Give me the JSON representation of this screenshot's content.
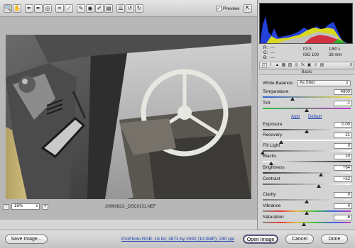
{
  "toolbar": {
    "tools": [
      {
        "icon": "zoom-icon",
        "glyph": "🔍"
      },
      {
        "icon": "hand-icon",
        "glyph": "✋"
      },
      {
        "icon": "white-balance-icon",
        "glyph": "✒"
      },
      {
        "icon": "color-sampler-icon",
        "glyph": "✒"
      },
      {
        "icon": "target-adjust-icon",
        "glyph": "◎"
      },
      {
        "icon": "crop-icon",
        "glyph": "⌗"
      },
      {
        "icon": "straighten-icon",
        "glyph": "⟋"
      },
      {
        "icon": "spot-removal-icon",
        "glyph": "✎"
      },
      {
        "icon": "red-eye-icon",
        "glyph": "◉"
      },
      {
        "icon": "adjustment-brush-icon",
        "glyph": "✐"
      },
      {
        "icon": "graduated-filter-icon",
        "glyph": "▤"
      },
      {
        "icon": "preferences-icon",
        "glyph": "☰"
      },
      {
        "icon": "rotate-ccw-icon",
        "glyph": "↺"
      },
      {
        "icon": "rotate-cw-icon",
        "glyph": "↻"
      }
    ],
    "preview_label": "Preview",
    "preview_checked": "✓",
    "fullscreen_glyph": "⇱"
  },
  "preview": {
    "zoom_minus": "-",
    "zoom_plus": "+",
    "zoom_value": "18%",
    "filename": "20090822-_DSC0131.NEF"
  },
  "info": {
    "r": "R:",
    "g": "G:",
    "b": "B:",
    "r_val": "---",
    "g_val": "---",
    "b_val": "---",
    "aperture": "f/3.5",
    "shutter": "1/80 s",
    "iso": "ISO 100",
    "focal": "28 mm"
  },
  "panel": {
    "tab_icons": [
      "aperture-icon",
      "tone-curve-icon",
      "detail-icon",
      "hsl-icon",
      "split-tone-icon",
      "lens-icon",
      "fx-icon",
      "camera-calibration-icon",
      "presets-icon",
      "snapshots-icon"
    ],
    "tab_glyphs": [
      "◐",
      "⌇",
      "▲",
      "▦",
      "▧",
      "◎",
      "fx",
      "▣",
      "≡",
      "▤"
    ],
    "menu_glyph": "≡",
    "section": "Basic",
    "white_balance_label": "White Balance:",
    "white_balance_value": "As Shot",
    "auto": "Auto",
    "default": "Default",
    "sliders": {
      "temperature": {
        "label": "Temperature",
        "value": "4900",
        "pos": 0.34
      },
      "tint": {
        "label": "Tint",
        "value": "-1",
        "pos": 0.5
      },
      "exposure": {
        "label": "Exposure",
        "value": "0.00",
        "pos": 0.5
      },
      "recovery": {
        "label": "Recovery",
        "value": "21",
        "pos": 0.21
      },
      "fill_light": {
        "label": "Fill Light",
        "value": "0",
        "pos": 0.0
      },
      "blacks": {
        "label": "Blacks",
        "value": "10",
        "pos": 0.1
      },
      "brightness": {
        "label": "Brightness",
        "value": "+64",
        "pos": 0.66
      },
      "contrast": {
        "label": "Contrast",
        "value": "+52",
        "pos": 0.64
      },
      "clarity": {
        "label": "Clarity",
        "value": "0",
        "pos": 0.5
      },
      "vibrance": {
        "label": "Vibrance",
        "value": "0",
        "pos": 0.5
      },
      "saturation": {
        "label": "Saturation",
        "value": "-6",
        "pos": 0.47
      }
    }
  },
  "bottom": {
    "save": "Save Image...",
    "workflow": "ProPhoto RGB; 16 bit; 3872 by 2592 (10.0MP); 240 ppi",
    "open": "Open Image",
    "cancel": "Cancel",
    "done": "Done"
  },
  "colors": {
    "accent_link": "#1a3fb0",
    "histogram_bg": "#000000"
  }
}
